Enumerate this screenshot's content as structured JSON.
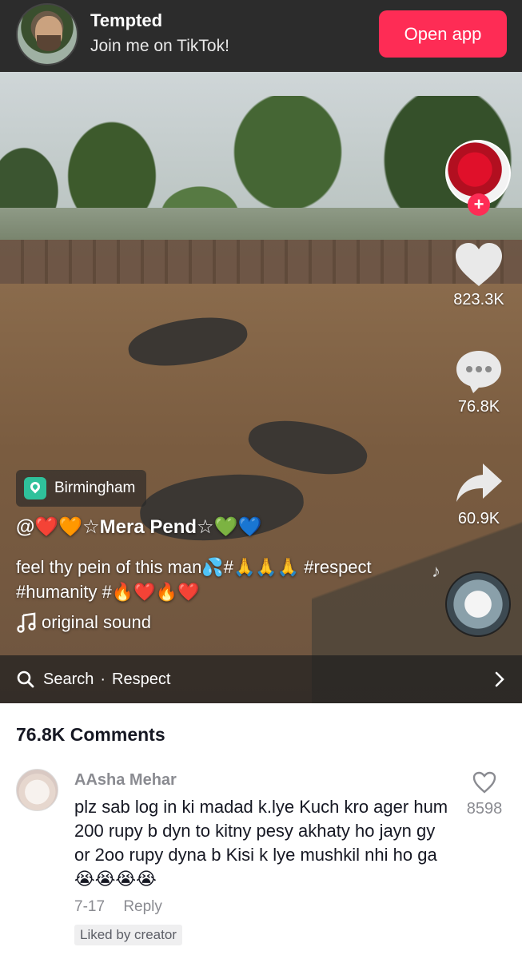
{
  "banner": {
    "title": "Tempted",
    "subtitle": "Join me on TikTok!",
    "open_button": "Open app",
    "accent_color": "#fe2c55"
  },
  "video": {
    "location": "Birmingham",
    "username": "@❤️🧡☆Mera Pend☆💚💙",
    "caption": "feel thy pein of this man💦#🙏🙏🙏 #respect #humanity #🔥❤️🔥❤️",
    "sound": "original sound",
    "search": {
      "label": "Search",
      "separator": "·",
      "term": "Respect"
    },
    "stats": {
      "likes": "823.3K",
      "comments": "76.8K",
      "shares": "60.9K"
    },
    "icons": {
      "follow": "+",
      "like": "heart-icon",
      "comment": "comment-bubble-icon",
      "share": "share-arrow-icon",
      "sound": "music-note-icon",
      "search": "search-icon",
      "chevron": "chevron-right-icon"
    }
  },
  "comments": {
    "header": "76.8K Comments",
    "items": [
      {
        "user": "AAsha Mehar",
        "text": "plz sab log in ki madad k.lye Kuch kro ager hum 200 rupy b dyn to kitny pesy akhaty ho jayn gy or 2oo rupy dyna b Kisi k lye mushkil nhi ho ga😭😭😭😭",
        "date": "7-17",
        "reply": "Reply",
        "badge": "Liked by creator",
        "likes": "8598"
      }
    ]
  }
}
